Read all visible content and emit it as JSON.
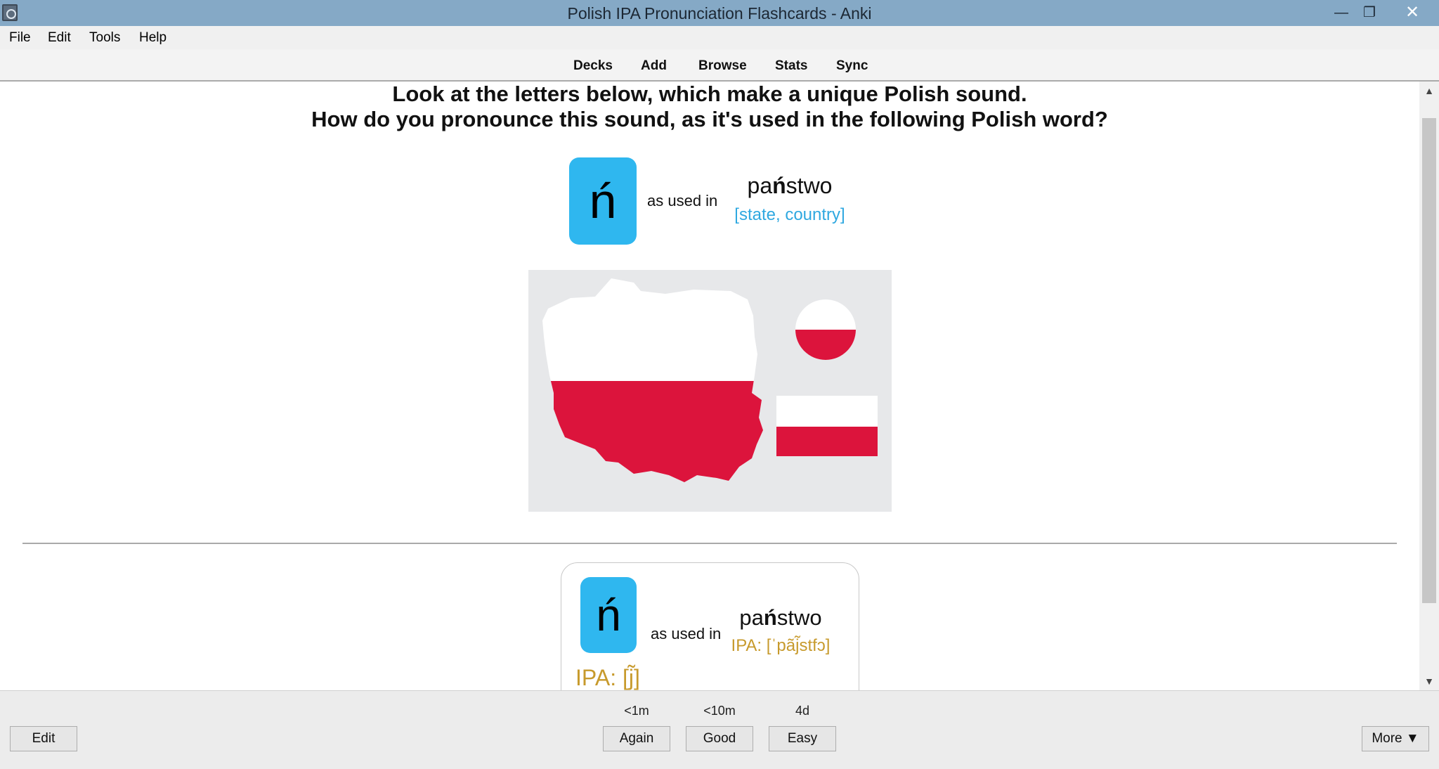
{
  "window": {
    "title": "Polish IPA Pronunciation Flashcards - Anki",
    "minimize": "—",
    "maximize": "❐",
    "close": "✕"
  },
  "menu": {
    "items": [
      "File",
      "Edit",
      "Tools",
      "Help"
    ]
  },
  "toolbar": {
    "items": [
      "Decks",
      "Add",
      "Browse",
      "Stats",
      "Sync"
    ]
  },
  "question": {
    "line1": "Look at the letters below, which make a unique Polish sound.",
    "line2": "How do you pronounce this sound, as it's used in the following Polish word?",
    "letter": "ń",
    "as_used_in": "as used in",
    "word_pre": "pa",
    "word_bold": "ń",
    "word_post": "stwo",
    "translation": "[state, country]"
  },
  "answer": {
    "letter": "ń",
    "as_used_in": "as used in",
    "word_pre": "pa",
    "word_bold": "ń",
    "word_post": "stwo",
    "ipa_word": "IPA: [ˈpãj̃stfɔ]",
    "ipa_sound": "IPA: [j̃]"
  },
  "bottom": {
    "edit_label": "Edit",
    "more_label": "More ▼",
    "answers": [
      {
        "label": "Again",
        "interval": "<1m"
      },
      {
        "label": "Good",
        "interval": "<10m"
      },
      {
        "label": "Easy",
        "interval": "4d"
      }
    ]
  },
  "colors": {
    "tile": "#2fb7ef",
    "translation": "#2fa8e0",
    "ipa": "#c79a2c",
    "flag_red": "#dc143c",
    "titlebar": "#85a9c6"
  }
}
